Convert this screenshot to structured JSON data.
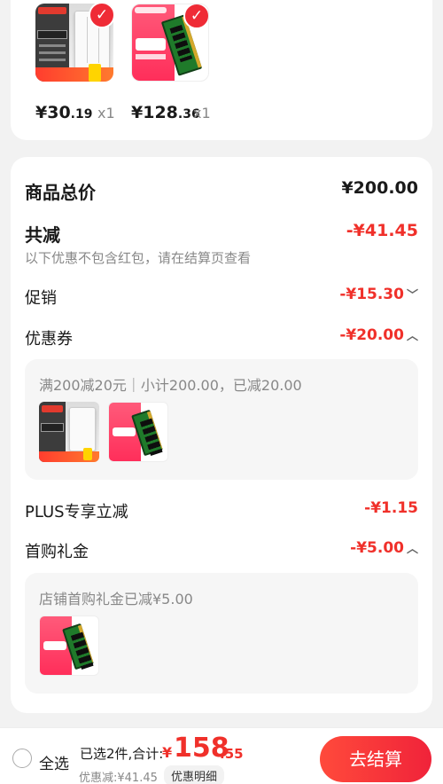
{
  "top_products": [
    {
      "name_icon": "smart-switch-product-image",
      "price_int": "¥30",
      "price_dec": ".19",
      "qty": "x1"
    },
    {
      "name_icon": "ram-module-product-image",
      "price_int": "¥128",
      "price_dec": ".36",
      "qty": "x1"
    }
  ],
  "summary": {
    "total_label": "商品总价",
    "total_value": "¥200.00",
    "reduce_label": "共减",
    "reduce_value": "-¥41.45",
    "reduce_note": "以下优惠不包含红包，请在结算页查看",
    "promo_label": "促销",
    "promo_value": "-¥15.30",
    "coupon_label": "优惠券",
    "coupon_value": "-¥20.00",
    "coupon_detail": "满200减20元｜小计200.00，已减20.00",
    "plus_label": "PLUS专享立减",
    "plus_value": "-¥1.15",
    "gift_label": "首购礼金",
    "gift_value": "-¥5.00",
    "gift_detail": "店铺首购礼金已减¥5.00"
  },
  "bottom_bar": {
    "select_all": "全选",
    "selected_summary": "已选2件,合计:",
    "currency": "¥",
    "total_int": "158",
    "total_dec": ".55",
    "discount_text": "优惠减:¥41.45",
    "detail_label": "优惠明细",
    "checkout_label": "去结算"
  },
  "colors": {
    "accent": "#f0302a",
    "background": "#f2f2f2"
  }
}
